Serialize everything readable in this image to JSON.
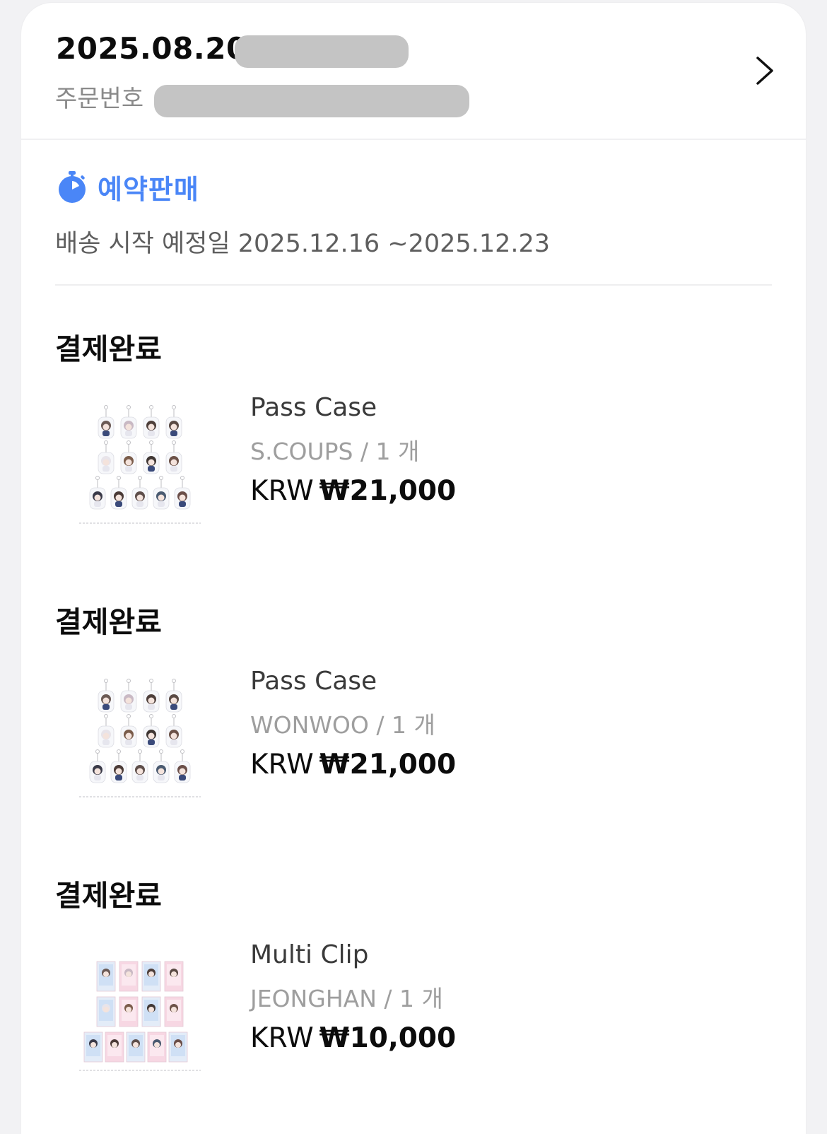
{
  "order": {
    "date": "2025.08.20",
    "number_label": "주문번호"
  },
  "presale": {
    "label": "예약판매",
    "shipping_text": "배송 시작 예정일 2025.12.16 ~2025.12.23",
    "icon": "stopwatch-icon",
    "accent_color": "#4a86f7"
  },
  "items": [
    {
      "status": "결제완료",
      "name": "Pass Case",
      "option": "S.COUPS / 1 개",
      "currency": "KRW",
      "price": "₩21,000",
      "thumbnail": "acrylic-keyring-set"
    },
    {
      "status": "결제완료",
      "name": "Pass Case",
      "option": "WONWOO / 1 개",
      "currency": "KRW",
      "price": "₩21,000",
      "thumbnail": "acrylic-keyring-set"
    },
    {
      "status": "결제완료",
      "name": "Multi Clip",
      "option": "JEONGHAN / 1 개",
      "currency": "KRW",
      "price": "₩10,000",
      "thumbnail": "clip-card-set"
    }
  ]
}
